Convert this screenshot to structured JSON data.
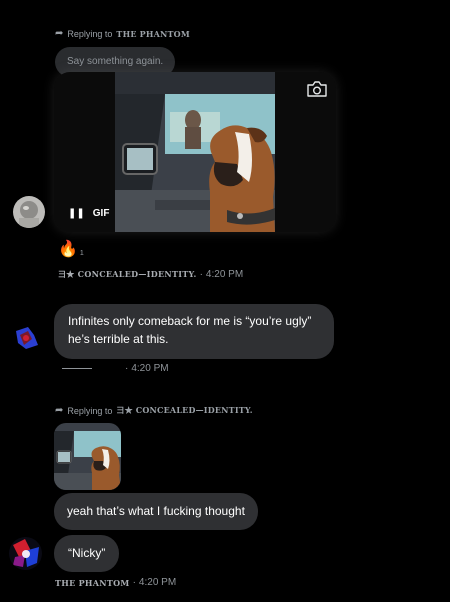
{
  "thread": {
    "block1": {
      "reply_label": "Replying to",
      "reply_name": "THE PHANTOM",
      "quoted_text": "Say something again.",
      "gif_badge": "GIF",
      "reaction_emoji": "🔥",
      "reaction_count": "1",
      "author": "⺕★ CONCEALED—IDENTITY.",
      "sep": "·",
      "time": "4:20 PM"
    },
    "block2": {
      "message": "Infinites only comeback for me is “you’re ugly” he’s terrible at this.",
      "author": "———",
      "sep": "·",
      "time": "4:20 PM"
    },
    "block3": {
      "reply_label": "Replying to",
      "reply_name": "⺕★ CONCEALED—IDENTITY.",
      "message1": "yeah that’s what I fucking thought",
      "message2": "“Nicky”",
      "author": "THE PHANTOM",
      "sep": "·",
      "time": "4:20 PM"
    }
  }
}
